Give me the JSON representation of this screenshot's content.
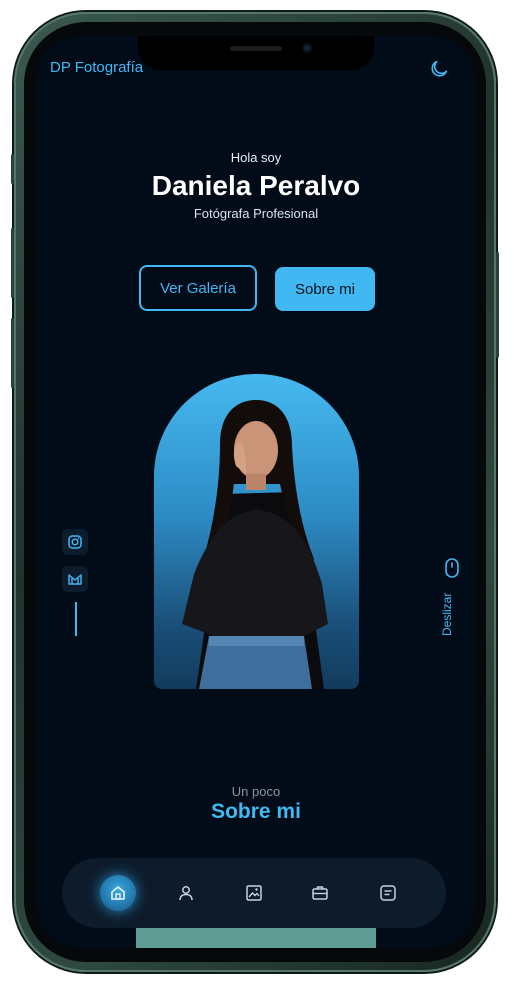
{
  "header": {
    "brand": "DP Fotografía",
    "theme_icon": "moon-icon"
  },
  "hero": {
    "greeting": "Hola soy",
    "name": "Daniela Peralvo",
    "role": "Fotógrafa Profesional",
    "buttons": {
      "gallery": "Ver Galería",
      "about": "Sobre mi"
    }
  },
  "social": {
    "items": [
      "instagram-icon",
      "mail-icon"
    ]
  },
  "scroll": {
    "label": "Deslizar",
    "icon": "mouse-icon"
  },
  "about": {
    "pre": "Un poco",
    "title": "Sobre mi"
  },
  "nav": {
    "items": [
      "home-icon",
      "user-icon",
      "image-icon",
      "briefcase-icon",
      "message-icon"
    ],
    "active": 0
  },
  "colors": {
    "accent": "#41b8f2",
    "background": "#020b18",
    "nav_bg": "#0d1b2a"
  }
}
